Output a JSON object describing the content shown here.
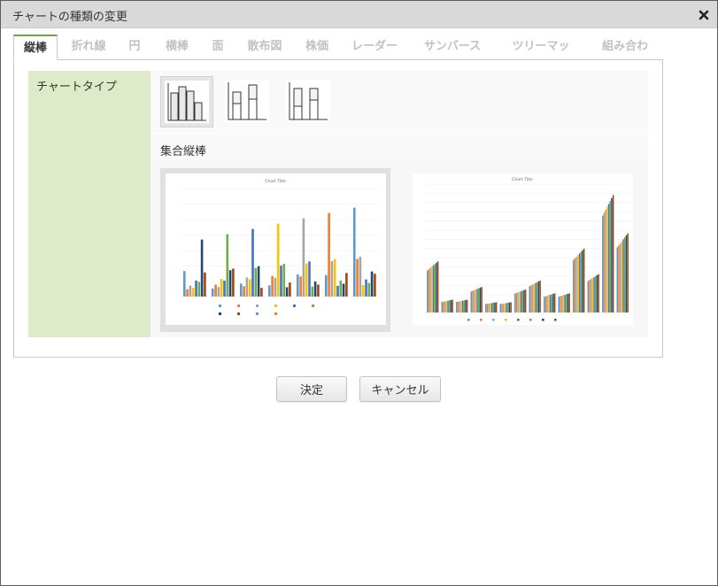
{
  "dialog": {
    "title": "チャートの種類の変更"
  },
  "tabs": [
    {
      "label": "縦棒",
      "active": true
    },
    {
      "label": "折れ線"
    },
    {
      "label": "円"
    },
    {
      "label": "横棒"
    },
    {
      "label": "面"
    },
    {
      "label": "散布図"
    },
    {
      "label": "株価"
    },
    {
      "label": "レーダー"
    },
    {
      "label": "サンバースト"
    },
    {
      "label": "ツリーマップ"
    },
    {
      "label": "組み合わせ"
    }
  ],
  "panel": {
    "side_label": "チャートタイプ",
    "subtype_name": "集合縦棒"
  },
  "previews": [
    {
      "title": "Chart Title",
      "selected": true
    },
    {
      "title": "Chart Title",
      "selected": false
    }
  ],
  "buttons": {
    "ok": "決定",
    "cancel": "キャンセル"
  },
  "colors": {
    "accent_green": "#7a9e3e",
    "side_bg": "#ddebc8",
    "series": [
      "#5b9bd5",
      "#ed7d31",
      "#a5a5a5",
      "#ffc000",
      "#4472c4",
      "#70ad47",
      "#264478",
      "#9e480e"
    ]
  }
}
